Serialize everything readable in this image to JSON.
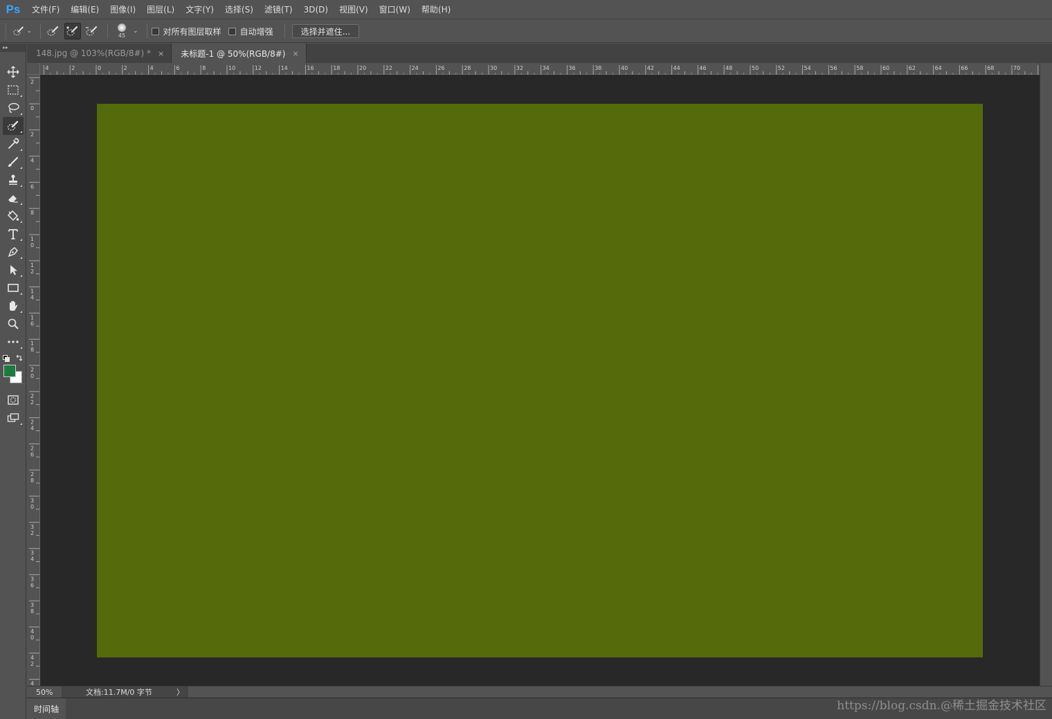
{
  "app": {
    "logo": "Ps",
    "menu": [
      "文件(F)",
      "编辑(E)",
      "图像(I)",
      "图层(L)",
      "文字(Y)",
      "选择(S)",
      "滤镜(T)",
      "3D(D)",
      "视图(V)",
      "窗口(W)",
      "帮助(H)"
    ]
  },
  "options": {
    "brush_size": "45",
    "sample_all_layers_label": "对所有图层取样",
    "sample_all_layers_checked": false,
    "auto_enhance_label": "自动增强",
    "auto_enhance_checked": false,
    "select_mask_label": "选择并遮住..."
  },
  "toolbar": {
    "header": "▸▸",
    "tools": [
      {
        "name": "move-tool",
        "icon": "move-icon"
      },
      {
        "name": "marquee-tool",
        "icon": "marquee-icon"
      },
      {
        "name": "lasso-tool",
        "icon": "lasso-icon"
      },
      {
        "name": "quick-selection-tool",
        "icon": "quick-selection-icon",
        "active": true
      },
      {
        "name": "eyedropper-tool",
        "icon": "eyedropper-icon"
      },
      {
        "name": "brush-tool",
        "icon": "brush-icon"
      },
      {
        "name": "clone-stamp-tool",
        "icon": "stamp-icon"
      },
      {
        "name": "eraser-tool",
        "icon": "eraser-icon"
      },
      {
        "name": "paint-bucket-tool",
        "icon": "bucket-icon"
      },
      {
        "name": "type-tool",
        "icon": "type-icon"
      },
      {
        "name": "pen-tool",
        "icon": "pen-icon"
      },
      {
        "name": "path-selection-tool",
        "icon": "arrow-icon"
      },
      {
        "name": "rectangle-tool",
        "icon": "rectangle-icon"
      },
      {
        "name": "hand-tool",
        "icon": "hand-icon"
      },
      {
        "name": "zoom-tool",
        "icon": "zoom-icon"
      },
      {
        "name": "more-tools",
        "icon": "more-icon"
      }
    ],
    "foreground_color": "#1d7a3e",
    "background_color": "#ffffff"
  },
  "tabs": [
    {
      "label": "148.jpg @ 103%(RGB/8#) *",
      "active": false
    },
    {
      "label": "未标题-1 @ 50%(RGB/8#)",
      "active": true
    }
  ],
  "tab_close_glyph": "×",
  "canvas": {
    "fill_color": "#556b0b",
    "pasteboard_color": "#282828"
  },
  "status": {
    "zoom": "50%",
    "doc_info": "文档:11.7M/0 字节",
    "arrow": "〉"
  },
  "timeline": {
    "label": "时间轴"
  },
  "watermark": "https://blog.csdn.@稀土掘金技术社区"
}
